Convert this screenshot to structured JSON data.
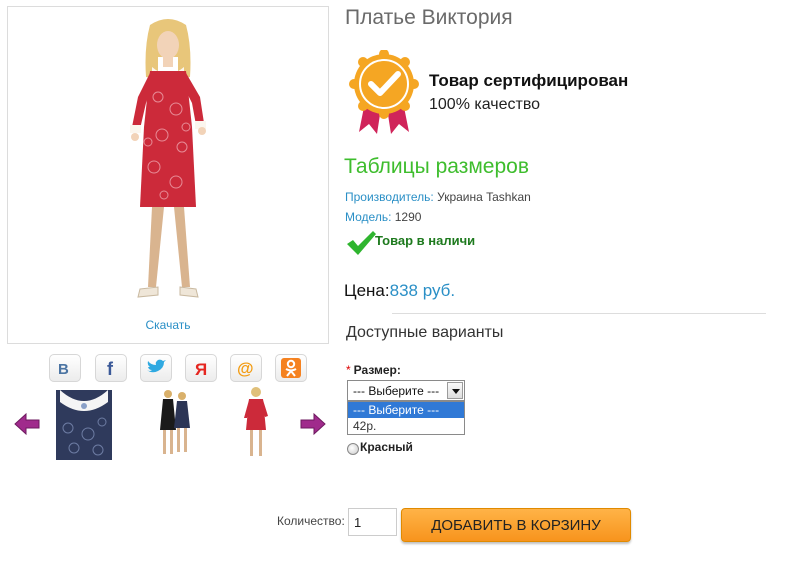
{
  "gallery": {
    "download_label": "Скачать"
  },
  "social": {
    "icons": [
      "vk-icon",
      "facebook-icon",
      "twitter-icon",
      "yandex-icon",
      "mail-icon",
      "odnoklassniki-icon"
    ]
  },
  "thumbnails": [
    "lace-collar-closeup",
    "two-girls-dresses",
    "girl-red-dress"
  ],
  "product": {
    "title": "Платье Виктория",
    "certified_title": "Товар сертифицирован",
    "certified_sub": "100% качество",
    "size_table_link": "Таблицы размеров",
    "manufacturer_label": "Производитель:",
    "manufacturer_value": "Украина Tashkan",
    "model_label": "Модель:",
    "model_value": "1290",
    "stock_status": "Товар в наличи",
    "price_label": "Цена:",
    "price_value": "838 руб."
  },
  "options": {
    "title": "Доступные варианты",
    "size_label": "Размер:",
    "size_required_mark": "*",
    "size_selected": "--- Выберите ---",
    "size_options": [
      "--- Выберите ---",
      "42р."
    ],
    "color_option": "Красный"
  },
  "cart": {
    "qty_label": "Количество:",
    "qty_value": "1",
    "add_button": "ДОБАВИТЬ В КОРЗИНУ"
  },
  "colors": {
    "accent_blue": "#2a8fc6",
    "link_green": "#3ebd2d",
    "stock_green": "#1e7a1e",
    "button_orange": "#f7941d",
    "dress_red": "#cc2a3a"
  }
}
